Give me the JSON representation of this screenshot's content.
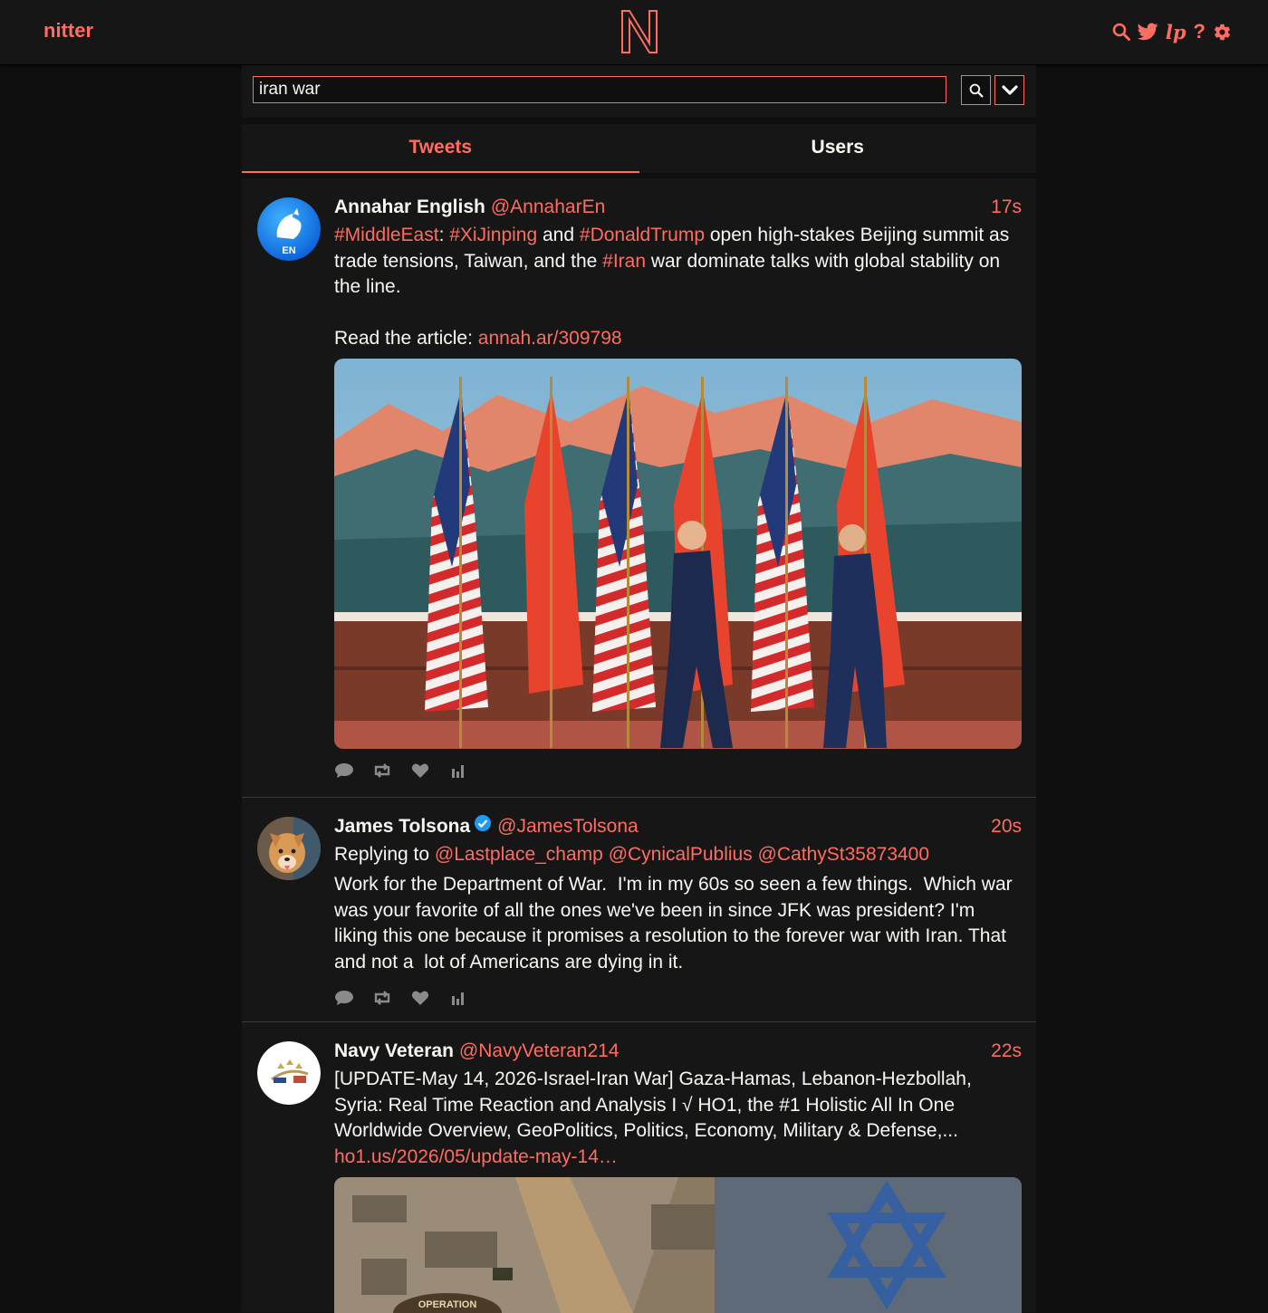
{
  "nav": {
    "brand": "nitter",
    "help_label": "?",
    "accent_color": "#ff6c60",
    "icons": [
      "search-icon",
      "twitter-bird-icon",
      "lp-icon",
      "help-icon",
      "gear-icon"
    ]
  },
  "search": {
    "query": "iran war"
  },
  "tabs": [
    {
      "label": "Tweets",
      "active": true
    },
    {
      "label": "Users",
      "active": false
    }
  ],
  "tweets": [
    {
      "fullname": "Annahar English",
      "username": "@AnnaharEn",
      "date": "17s",
      "hashtag1": "#MiddleEast",
      "colon": ":",
      "hashtag2": "#XiJinping",
      "and": "and",
      "hashtag3": "#DonaldTrump",
      "text1": "open high-stakes Beijing summit as trade tensions, Taiwan, and the",
      "hashtag4": "#Iran",
      "text2": "war dominate talks with global stability on the line.",
      "read_label": "Read the article:",
      "link": "annah.ar/309798",
      "avatar_badge": "EN"
    },
    {
      "fullname": "James Tolsona",
      "username": "@JamesTolsona",
      "date": "20s",
      "verified": true,
      "replying_label": "Replying to",
      "replying": [
        "@Lastplace_champ",
        "@CynicalPublius",
        "@CathySt35873400"
      ],
      "text": "Work for the Department of War.  I'm in my 60s so seen a few things.  Which war was your favorite of all the ones we've been in since JFK was president? I'm liking this one because it promises a resolution to the forever war with Iran. That and not a  lot of Americans are dying in it."
    },
    {
      "fullname": "Navy Veteran",
      "username": "@NavyVeteran214",
      "date": "22s",
      "text": "[UPDATE-May 14, 2026-Israel-Iran War] Gaza-Hamas, Lebanon-Hezbollah, Syria: Real Time Reaction and Analysis I √ HO1, the #1 Holistic All In One Worldwide Overview, GeoPolitics, Politics, Economy, Military & Defense,...",
      "link": "ho1.us/2026/05/update-may-14…",
      "media_caption": "OPERATION"
    }
  ]
}
